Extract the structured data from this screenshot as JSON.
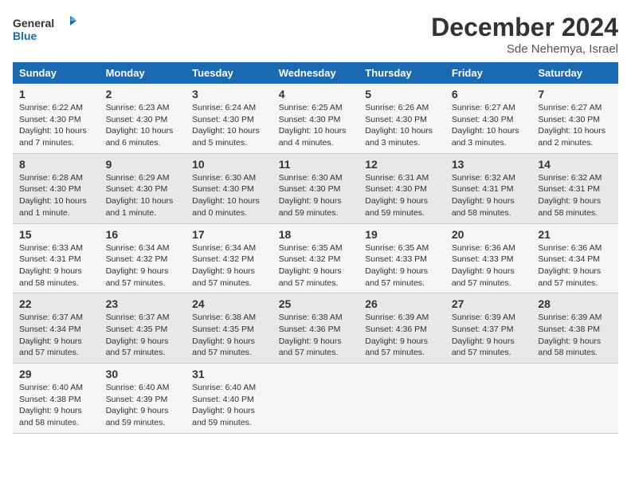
{
  "header": {
    "logo_line1": "General",
    "logo_line2": "Blue",
    "month": "December 2024",
    "location": "Sde Nehemya, Israel"
  },
  "days_of_week": [
    "Sunday",
    "Monday",
    "Tuesday",
    "Wednesday",
    "Thursday",
    "Friday",
    "Saturday"
  ],
  "weeks": [
    [
      {
        "day": "1",
        "info": "Sunrise: 6:22 AM\nSunset: 4:30 PM\nDaylight: 10 hours\nand 7 minutes."
      },
      {
        "day": "2",
        "info": "Sunrise: 6:23 AM\nSunset: 4:30 PM\nDaylight: 10 hours\nand 6 minutes."
      },
      {
        "day": "3",
        "info": "Sunrise: 6:24 AM\nSunset: 4:30 PM\nDaylight: 10 hours\nand 5 minutes."
      },
      {
        "day": "4",
        "info": "Sunrise: 6:25 AM\nSunset: 4:30 PM\nDaylight: 10 hours\nand 4 minutes."
      },
      {
        "day": "5",
        "info": "Sunrise: 6:26 AM\nSunset: 4:30 PM\nDaylight: 10 hours\nand 3 minutes."
      },
      {
        "day": "6",
        "info": "Sunrise: 6:27 AM\nSunset: 4:30 PM\nDaylight: 10 hours\nand 3 minutes."
      },
      {
        "day": "7",
        "info": "Sunrise: 6:27 AM\nSunset: 4:30 PM\nDaylight: 10 hours\nand 2 minutes."
      }
    ],
    [
      {
        "day": "8",
        "info": "Sunrise: 6:28 AM\nSunset: 4:30 PM\nDaylight: 10 hours\nand 1 minute."
      },
      {
        "day": "9",
        "info": "Sunrise: 6:29 AM\nSunset: 4:30 PM\nDaylight: 10 hours\nand 1 minute."
      },
      {
        "day": "10",
        "info": "Sunrise: 6:30 AM\nSunset: 4:30 PM\nDaylight: 10 hours\nand 0 minutes."
      },
      {
        "day": "11",
        "info": "Sunrise: 6:30 AM\nSunset: 4:30 PM\nDaylight: 9 hours\nand 59 minutes."
      },
      {
        "day": "12",
        "info": "Sunrise: 6:31 AM\nSunset: 4:30 PM\nDaylight: 9 hours\nand 59 minutes."
      },
      {
        "day": "13",
        "info": "Sunrise: 6:32 AM\nSunset: 4:31 PM\nDaylight: 9 hours\nand 58 minutes."
      },
      {
        "day": "14",
        "info": "Sunrise: 6:32 AM\nSunset: 4:31 PM\nDaylight: 9 hours\nand 58 minutes."
      }
    ],
    [
      {
        "day": "15",
        "info": "Sunrise: 6:33 AM\nSunset: 4:31 PM\nDaylight: 9 hours\nand 58 minutes."
      },
      {
        "day": "16",
        "info": "Sunrise: 6:34 AM\nSunset: 4:32 PM\nDaylight: 9 hours\nand 57 minutes."
      },
      {
        "day": "17",
        "info": "Sunrise: 6:34 AM\nSunset: 4:32 PM\nDaylight: 9 hours\nand 57 minutes."
      },
      {
        "day": "18",
        "info": "Sunrise: 6:35 AM\nSunset: 4:32 PM\nDaylight: 9 hours\nand 57 minutes."
      },
      {
        "day": "19",
        "info": "Sunrise: 6:35 AM\nSunset: 4:33 PM\nDaylight: 9 hours\nand 57 minutes."
      },
      {
        "day": "20",
        "info": "Sunrise: 6:36 AM\nSunset: 4:33 PM\nDaylight: 9 hours\nand 57 minutes."
      },
      {
        "day": "21",
        "info": "Sunrise: 6:36 AM\nSunset: 4:34 PM\nDaylight: 9 hours\nand 57 minutes."
      }
    ],
    [
      {
        "day": "22",
        "info": "Sunrise: 6:37 AM\nSunset: 4:34 PM\nDaylight: 9 hours\nand 57 minutes."
      },
      {
        "day": "23",
        "info": "Sunrise: 6:37 AM\nSunset: 4:35 PM\nDaylight: 9 hours\nand 57 minutes."
      },
      {
        "day": "24",
        "info": "Sunrise: 6:38 AM\nSunset: 4:35 PM\nDaylight: 9 hours\nand 57 minutes."
      },
      {
        "day": "25",
        "info": "Sunrise: 6:38 AM\nSunset: 4:36 PM\nDaylight: 9 hours\nand 57 minutes."
      },
      {
        "day": "26",
        "info": "Sunrise: 6:39 AM\nSunset: 4:36 PM\nDaylight: 9 hours\nand 57 minutes."
      },
      {
        "day": "27",
        "info": "Sunrise: 6:39 AM\nSunset: 4:37 PM\nDaylight: 9 hours\nand 57 minutes."
      },
      {
        "day": "28",
        "info": "Sunrise: 6:39 AM\nSunset: 4:38 PM\nDaylight: 9 hours\nand 58 minutes."
      }
    ],
    [
      {
        "day": "29",
        "info": "Sunrise: 6:40 AM\nSunset: 4:38 PM\nDaylight: 9 hours\nand 58 minutes."
      },
      {
        "day": "30",
        "info": "Sunrise: 6:40 AM\nSunset: 4:39 PM\nDaylight: 9 hours\nand 59 minutes."
      },
      {
        "day": "31",
        "info": "Sunrise: 6:40 AM\nSunset: 4:40 PM\nDaylight: 9 hours\nand 59 minutes."
      },
      null,
      null,
      null,
      null
    ]
  ]
}
